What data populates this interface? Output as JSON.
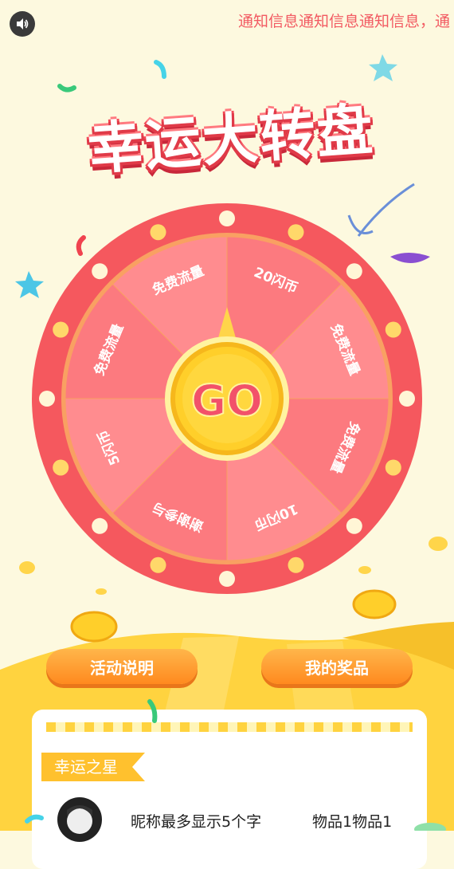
{
  "header": {
    "sound_icon": "speaker-icon",
    "notice": "通知信息通知信息通知信息，通"
  },
  "title": "幸运大转盘",
  "wheel": {
    "center_label": "GO",
    "segments": [
      "20闪币",
      "免费流量",
      "免费流量",
      "10闪币",
      "谢谢参与",
      "5闪币",
      "免费流量",
      "免费流量"
    ]
  },
  "buttons": {
    "rules": "活动说明",
    "prizes": "我的奖品"
  },
  "winners": {
    "tag": "幸运之星",
    "rows": [
      {
        "name": "昵称最多显示5个字",
        "prize": "物品1物品1"
      }
    ]
  },
  "colors": {
    "wheel_outer": "#f5585e",
    "wheel_inner_a": "#fc7a7f",
    "wheel_inner_b": "#ff8c8f",
    "gold": "#ffd23a",
    "notice": "#f25a62"
  }
}
